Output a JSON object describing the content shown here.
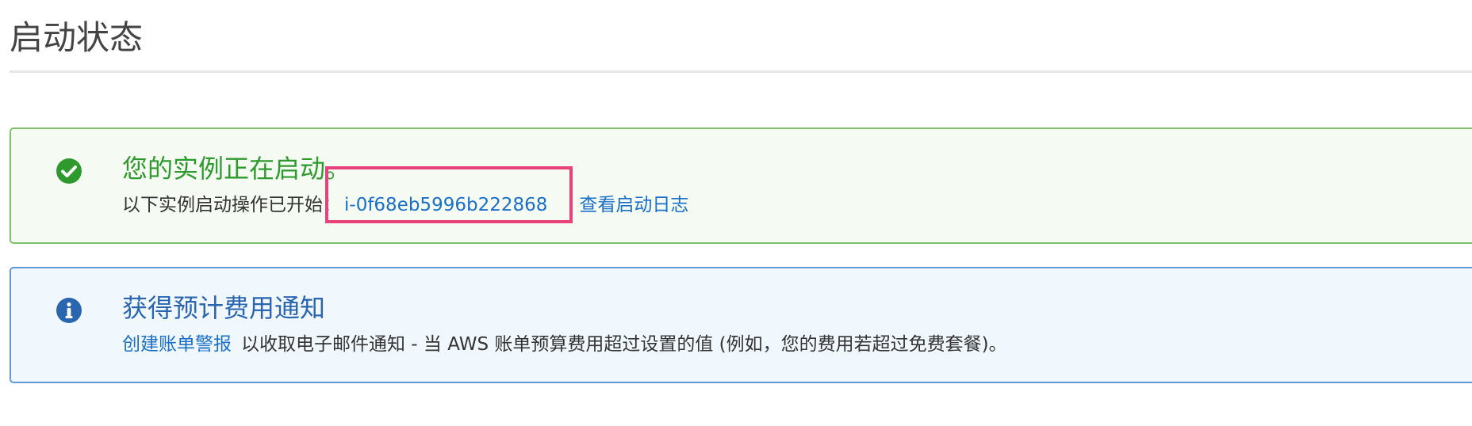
{
  "page": {
    "title": "启动状态"
  },
  "success_alert": {
    "icon": "check-circle-icon",
    "color": "#2e9a2e",
    "heading": "您的实例正在启动。",
    "message_prefix": "以下实例启动操作已开始：",
    "instance_id": "i-0f68eb5996b222868",
    "view_log_label": "查看启动日志"
  },
  "info_alert": {
    "icon": "info-circle-icon",
    "color": "#2a66b0",
    "heading": "获得预计费用通知",
    "link_label": "创建账单警报",
    "message": "以收取电子邮件通知 - 当 AWS 账单预算费用超过设置的值 (例如，您的费用若超过免费套餐)。"
  },
  "colors": {
    "link": "#1a6fc9",
    "highlight": "#e8417b"
  }
}
